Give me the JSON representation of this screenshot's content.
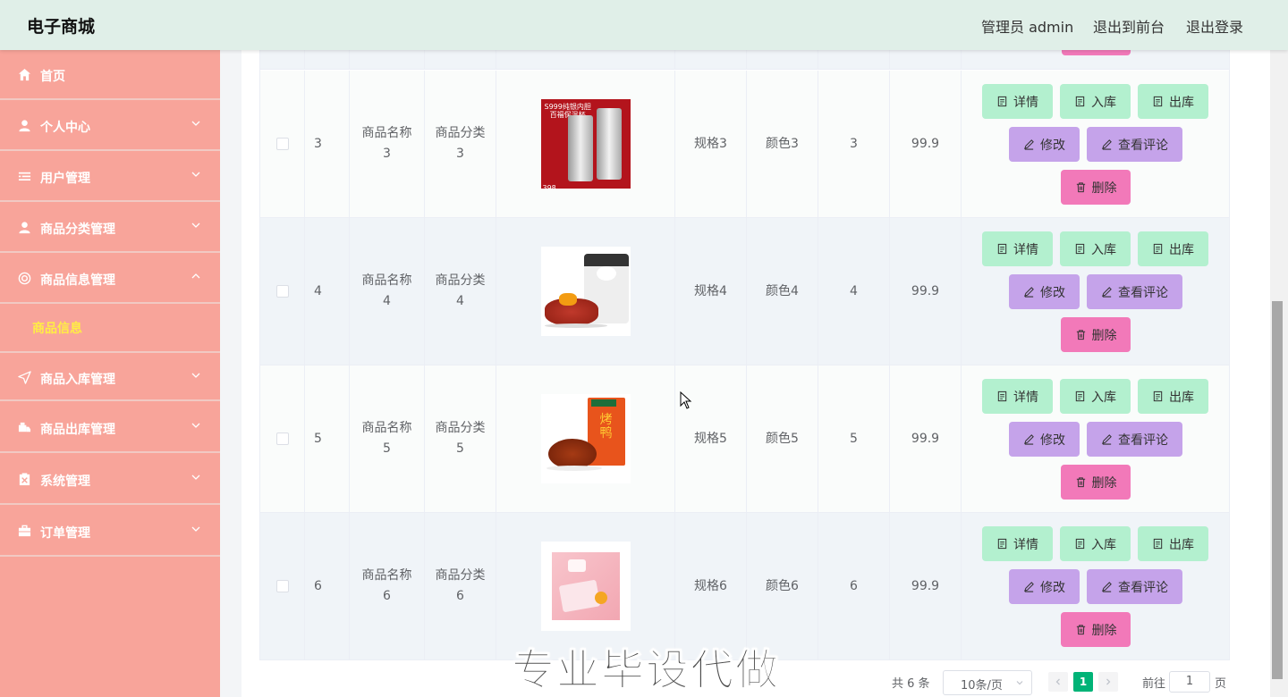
{
  "header": {
    "brand": "电子商城",
    "user_label": "管理员 admin",
    "to_front": "退出到前台",
    "logout": "退出登录"
  },
  "sidebar": {
    "items": [
      {
        "label": "首页",
        "icon": "home-icon",
        "expanded": false
      },
      {
        "label": "个人中心",
        "icon": "user-icon",
        "expanded": false
      },
      {
        "label": "用户管理",
        "icon": "list-icon",
        "expanded": false
      },
      {
        "label": "商品分类管理",
        "icon": "user-icon",
        "expanded": false
      },
      {
        "label": "商品信息管理",
        "icon": "aperture-icon",
        "expanded": true
      },
      {
        "label": "商品入库管理",
        "icon": "send-icon",
        "expanded": false
      },
      {
        "label": "商品出库管理",
        "icon": "truck-icon",
        "expanded": false
      },
      {
        "label": "系统管理",
        "icon": "clipboard-icon",
        "expanded": false
      },
      {
        "label": "订单管理",
        "icon": "briefcase-icon",
        "expanded": false
      }
    ],
    "subitem": "商品信息"
  },
  "table": {
    "rows": [
      {
        "id": "3",
        "name": "商品名称\n3",
        "category": "商品分类\n3",
        "image": "thermos-cup-image",
        "spec": "规格3",
        "color": "颜色3",
        "stock": "3",
        "price": "99.9"
      },
      {
        "id": "4",
        "name": "商品名称\n4",
        "category": "商品分类\n4",
        "image": "cat-snack-box-image",
        "spec": "规格4",
        "color": "颜色4",
        "stock": "4",
        "price": "99.9"
      },
      {
        "id": "5",
        "name": "商品名称\n5",
        "category": "商品分类\n5",
        "image": "roast-duck-image",
        "spec": "规格5",
        "color": "颜色5",
        "stock": "5",
        "price": "99.9"
      },
      {
        "id": "6",
        "name": "商品名称\n6",
        "category": "商品分类\n6",
        "image": "pink-pastry-image",
        "spec": "规格6",
        "color": "颜色6",
        "stock": "6",
        "price": "99.9"
      }
    ],
    "actions": {
      "detail": "详情",
      "stock_in": "入库",
      "stock_out": "出库",
      "edit": "修改",
      "comments": "查看评论",
      "delete": "删除"
    }
  },
  "pagination": {
    "total": "共 6 条",
    "page_size": "10条/页",
    "current": "1",
    "goto_label": "前往",
    "goto_value": "1",
    "page_suffix": "页"
  },
  "watermark": "专业毕设代做",
  "colors": {
    "header_bg": "#e0efe8",
    "sidebar_bg": "#f8a49a",
    "active_sub": "#ffee44",
    "btn_green": "#b3f0cf",
    "btn_purple": "#c5a3ea",
    "btn_pink": "#f279b9",
    "pager_active": "#00b377"
  }
}
